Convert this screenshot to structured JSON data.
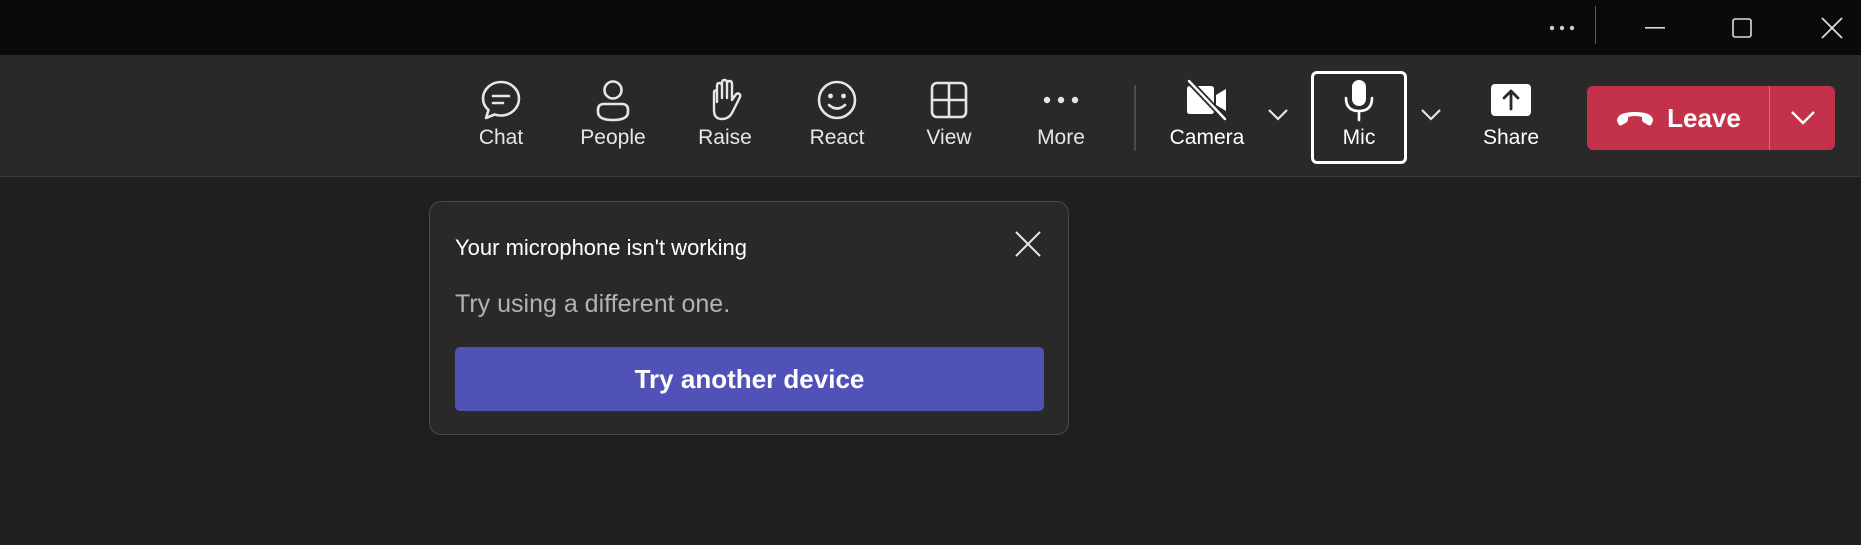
{
  "titlebar": {
    "more_icon": "more-horizontal-icon",
    "minimize_icon": "minimize-icon",
    "maximize_icon": "maximize-icon",
    "close_icon": "close-icon"
  },
  "toolbar": {
    "chat": {
      "label": "Chat",
      "icon": "chat-icon"
    },
    "people": {
      "label": "People",
      "icon": "people-icon"
    },
    "raise": {
      "label": "Raise",
      "icon": "raise-hand-icon"
    },
    "react": {
      "label": "React",
      "icon": "smiley-icon"
    },
    "view": {
      "label": "View",
      "icon": "grid-icon"
    },
    "more": {
      "label": "More",
      "icon": "more-horizontal-icon"
    },
    "camera": {
      "label": "Camera",
      "icon": "camera-off-icon",
      "state": "off"
    },
    "mic": {
      "label": "Mic",
      "icon": "microphone-icon",
      "state": "on"
    },
    "share": {
      "label": "Share",
      "icon": "share-screen-icon"
    },
    "leave": {
      "label": "Leave",
      "icon": "phone-hangup-icon"
    }
  },
  "popup": {
    "title": "Your microphone isn't working",
    "body": "Try using a different one.",
    "action_label": "Try another device"
  },
  "colors": {
    "titlebar_bg": "#0a0a0a",
    "toolbar_bg": "#292929",
    "canvas_bg": "#1f1f1f",
    "leave_red": "#c4314b",
    "accent_purple": "#5052b8"
  }
}
